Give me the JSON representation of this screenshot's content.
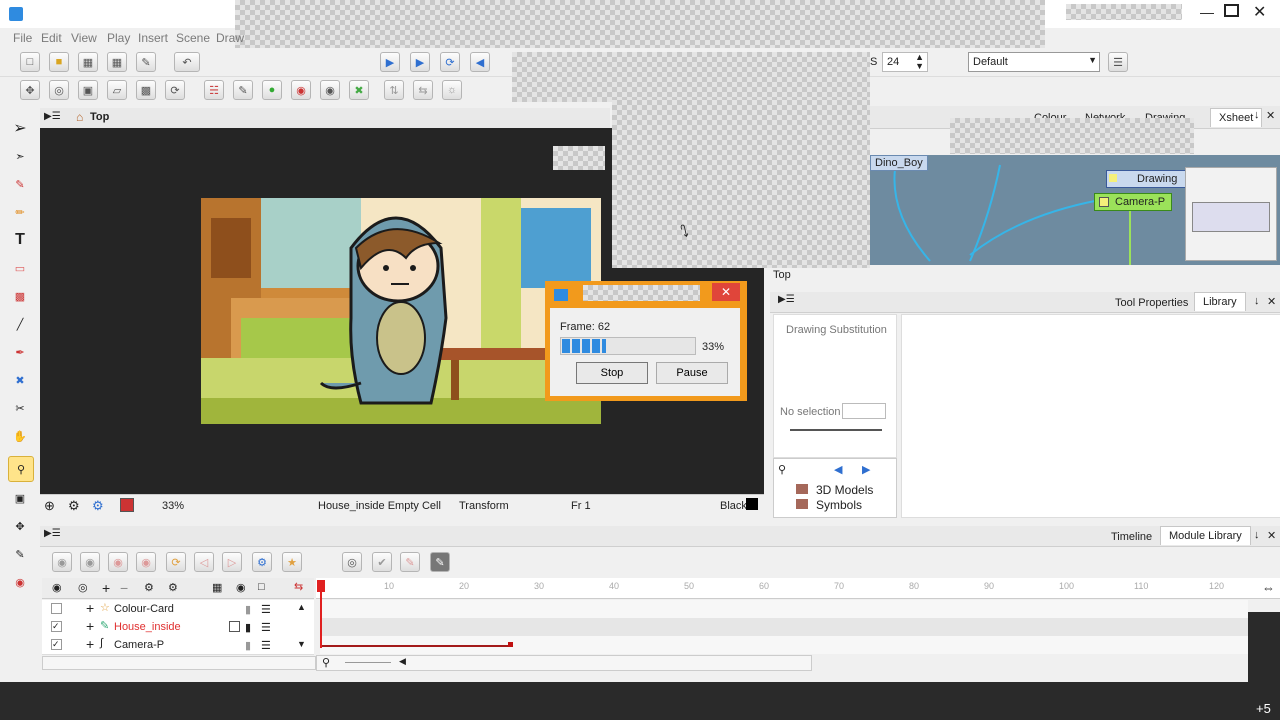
{
  "menu": [
    "File",
    "Edit",
    "View",
    "Play",
    "Insert",
    "Scene",
    "Draw"
  ],
  "toolbar": {
    "fps_prefix": "S",
    "fps_value": "24",
    "preset": "Default"
  },
  "right_tabs": [
    "Colour",
    "Network",
    "Drawing",
    "Xsheet"
  ],
  "camera_view": {
    "breadcrumb": "Top"
  },
  "status": {
    "zoom": "33%",
    "cell": "House_inside Empty Cell",
    "tool": "Transform",
    "frame": "Fr 1",
    "color": "Black"
  },
  "node_view": {
    "nodes": [
      "Dino_Boy",
      "Drawing",
      "Camera-P"
    ],
    "footer": "Top"
  },
  "tool_props": {
    "tab1": "Tool Properties",
    "tab2": "Library",
    "section": "Drawing Substitution",
    "no_selection": "No selection"
  },
  "library": {
    "items": [
      "3D Models",
      "Symbols"
    ]
  },
  "render_dialog": {
    "frame_label": "Frame: 62",
    "progress": 33,
    "progress_text": "33%",
    "stop": "Stop",
    "pause": "Pause"
  },
  "timeline": {
    "tabs": [
      "Timeline",
      "Module Library"
    ],
    "layers": [
      {
        "name": "Colour-Card",
        "checked": false,
        "color": "#222"
      },
      {
        "name": "House_inside",
        "checked": true,
        "color": "#e03030"
      },
      {
        "name": "Camera-P",
        "checked": true,
        "color": "#222"
      }
    ],
    "ruler": [
      "10",
      "20",
      "30",
      "40",
      "50",
      "60",
      "70",
      "80",
      "90",
      "100",
      "110",
      "120"
    ]
  },
  "overlay": {
    "plus_count": "+5"
  },
  "colors": {
    "accent": "#2f8be0",
    "dialog_border": "#f29a1c",
    "dialog_close": "#e0453a",
    "playhead": "#e02020",
    "node_yellow": "#f5f07a",
    "node_green": "#9be25a"
  }
}
